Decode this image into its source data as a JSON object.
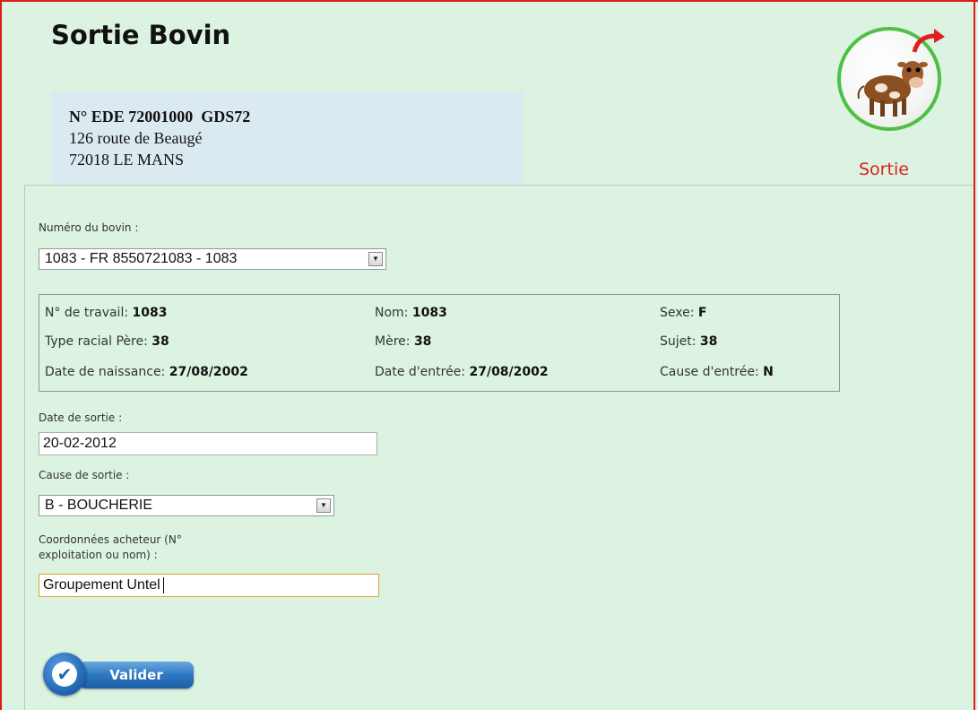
{
  "page": {
    "title": "Sortie Bovin"
  },
  "address": {
    "ede": "N° EDE 72001000  GDS72",
    "street": "126 route de Beaugé",
    "city": "72018 LE MANS"
  },
  "badge": {
    "icon": "cow-exit-icon",
    "label": "Sortie",
    "color": "#d82020"
  },
  "form": {
    "bovin_label": "Numéro du bovin :",
    "bovin_value": "1083 - FR 8550721083 - 1083",
    "date_label": "Date de sortie :",
    "date_value": "20-02-2012",
    "cause_label": "Cause de sortie :",
    "cause_value": "B - BOUCHERIE",
    "buyer_label_line1": "Coordonnées acheteur (N°",
    "buyer_label_line2": "exploitation ou nom) :",
    "buyer_value": "Groupement Untel",
    "submit_label": "Valider"
  },
  "info": {
    "travail_label": "N° de travail:",
    "travail_value": "1083",
    "nom_label": "Nom:",
    "nom_value": "1083",
    "sexe_label": "Sexe:",
    "sexe_value": "F",
    "pere_label": "Type racial Père:",
    "pere_value": "38",
    "mere_label": "Mère:",
    "mere_value": "38",
    "sujet_label": "Sujet:",
    "sujet_value": "38",
    "naissance_label": "Date de naissance:",
    "naissance_value": "27/08/2002",
    "entree_label": "Date d'entrée:",
    "entree_value": "27/08/2002",
    "cause_entree_label": "Cause d'entrée:",
    "cause_entree_value": "N"
  },
  "colors": {
    "background": "#ddf3e1",
    "frame_border": "#e01a1a",
    "address_bg": "#dbeaf0",
    "button": "#2e78c2",
    "focus": "#e0a52a"
  }
}
